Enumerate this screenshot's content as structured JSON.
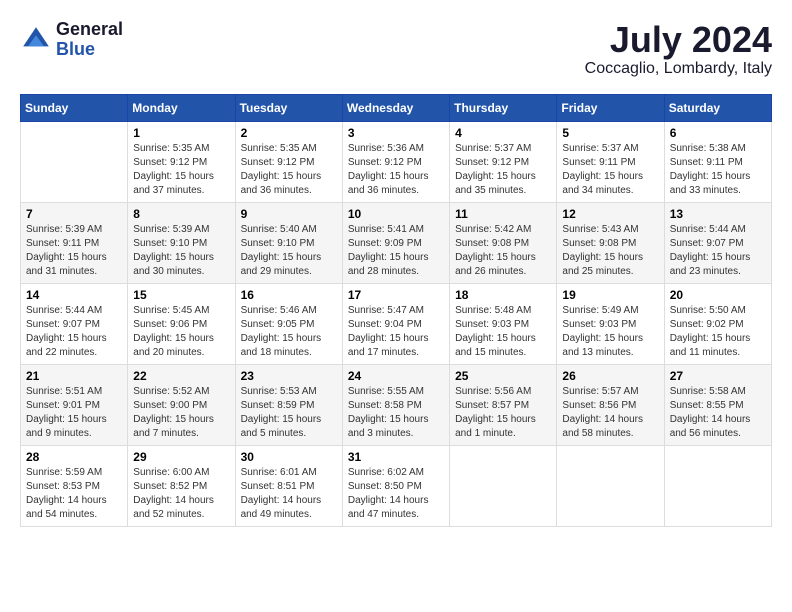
{
  "header": {
    "logo_general": "General",
    "logo_blue": "Blue",
    "month_year": "July 2024",
    "location": "Coccaglio, Lombardy, Italy"
  },
  "calendar": {
    "headers": [
      "Sunday",
      "Monday",
      "Tuesday",
      "Wednesday",
      "Thursday",
      "Friday",
      "Saturday"
    ],
    "weeks": [
      [
        {
          "day": "",
          "info": ""
        },
        {
          "day": "1",
          "info": "Sunrise: 5:35 AM\nSunset: 9:12 PM\nDaylight: 15 hours\nand 37 minutes."
        },
        {
          "day": "2",
          "info": "Sunrise: 5:35 AM\nSunset: 9:12 PM\nDaylight: 15 hours\nand 36 minutes."
        },
        {
          "day": "3",
          "info": "Sunrise: 5:36 AM\nSunset: 9:12 PM\nDaylight: 15 hours\nand 36 minutes."
        },
        {
          "day": "4",
          "info": "Sunrise: 5:37 AM\nSunset: 9:12 PM\nDaylight: 15 hours\nand 35 minutes."
        },
        {
          "day": "5",
          "info": "Sunrise: 5:37 AM\nSunset: 9:11 PM\nDaylight: 15 hours\nand 34 minutes."
        },
        {
          "day": "6",
          "info": "Sunrise: 5:38 AM\nSunset: 9:11 PM\nDaylight: 15 hours\nand 33 minutes."
        }
      ],
      [
        {
          "day": "7",
          "info": "Sunrise: 5:39 AM\nSunset: 9:11 PM\nDaylight: 15 hours\nand 31 minutes."
        },
        {
          "day": "8",
          "info": "Sunrise: 5:39 AM\nSunset: 9:10 PM\nDaylight: 15 hours\nand 30 minutes."
        },
        {
          "day": "9",
          "info": "Sunrise: 5:40 AM\nSunset: 9:10 PM\nDaylight: 15 hours\nand 29 minutes."
        },
        {
          "day": "10",
          "info": "Sunrise: 5:41 AM\nSunset: 9:09 PM\nDaylight: 15 hours\nand 28 minutes."
        },
        {
          "day": "11",
          "info": "Sunrise: 5:42 AM\nSunset: 9:08 PM\nDaylight: 15 hours\nand 26 minutes."
        },
        {
          "day": "12",
          "info": "Sunrise: 5:43 AM\nSunset: 9:08 PM\nDaylight: 15 hours\nand 25 minutes."
        },
        {
          "day": "13",
          "info": "Sunrise: 5:44 AM\nSunset: 9:07 PM\nDaylight: 15 hours\nand 23 minutes."
        }
      ],
      [
        {
          "day": "14",
          "info": "Sunrise: 5:44 AM\nSunset: 9:07 PM\nDaylight: 15 hours\nand 22 minutes."
        },
        {
          "day": "15",
          "info": "Sunrise: 5:45 AM\nSunset: 9:06 PM\nDaylight: 15 hours\nand 20 minutes."
        },
        {
          "day": "16",
          "info": "Sunrise: 5:46 AM\nSunset: 9:05 PM\nDaylight: 15 hours\nand 18 minutes."
        },
        {
          "day": "17",
          "info": "Sunrise: 5:47 AM\nSunset: 9:04 PM\nDaylight: 15 hours\nand 17 minutes."
        },
        {
          "day": "18",
          "info": "Sunrise: 5:48 AM\nSunset: 9:03 PM\nDaylight: 15 hours\nand 15 minutes."
        },
        {
          "day": "19",
          "info": "Sunrise: 5:49 AM\nSunset: 9:03 PM\nDaylight: 15 hours\nand 13 minutes."
        },
        {
          "day": "20",
          "info": "Sunrise: 5:50 AM\nSunset: 9:02 PM\nDaylight: 15 hours\nand 11 minutes."
        }
      ],
      [
        {
          "day": "21",
          "info": "Sunrise: 5:51 AM\nSunset: 9:01 PM\nDaylight: 15 hours\nand 9 minutes."
        },
        {
          "day": "22",
          "info": "Sunrise: 5:52 AM\nSunset: 9:00 PM\nDaylight: 15 hours\nand 7 minutes."
        },
        {
          "day": "23",
          "info": "Sunrise: 5:53 AM\nSunset: 8:59 PM\nDaylight: 15 hours\nand 5 minutes."
        },
        {
          "day": "24",
          "info": "Sunrise: 5:55 AM\nSunset: 8:58 PM\nDaylight: 15 hours\nand 3 minutes."
        },
        {
          "day": "25",
          "info": "Sunrise: 5:56 AM\nSunset: 8:57 PM\nDaylight: 15 hours\nand 1 minute."
        },
        {
          "day": "26",
          "info": "Sunrise: 5:57 AM\nSunset: 8:56 PM\nDaylight: 14 hours\nand 58 minutes."
        },
        {
          "day": "27",
          "info": "Sunrise: 5:58 AM\nSunset: 8:55 PM\nDaylight: 14 hours\nand 56 minutes."
        }
      ],
      [
        {
          "day": "28",
          "info": "Sunrise: 5:59 AM\nSunset: 8:53 PM\nDaylight: 14 hours\nand 54 minutes."
        },
        {
          "day": "29",
          "info": "Sunrise: 6:00 AM\nSunset: 8:52 PM\nDaylight: 14 hours\nand 52 minutes."
        },
        {
          "day": "30",
          "info": "Sunrise: 6:01 AM\nSunset: 8:51 PM\nDaylight: 14 hours\nand 49 minutes."
        },
        {
          "day": "31",
          "info": "Sunrise: 6:02 AM\nSunset: 8:50 PM\nDaylight: 14 hours\nand 47 minutes."
        },
        {
          "day": "",
          "info": ""
        },
        {
          "day": "",
          "info": ""
        },
        {
          "day": "",
          "info": ""
        }
      ]
    ]
  }
}
